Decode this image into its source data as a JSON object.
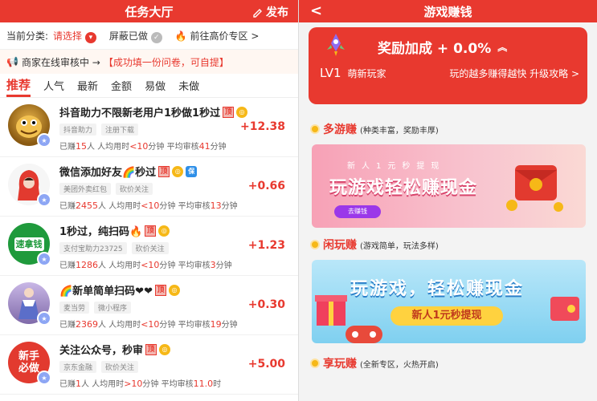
{
  "left": {
    "title": "任务大厅",
    "publish_label": "发布",
    "filter": {
      "current_label": "当前分类:",
      "select_label": "请选择",
      "hidden_label": "屏蔽已做",
      "premium_label": "前往高价专区 >"
    },
    "notice": {
      "text": "商家在线审核中 →",
      "highlight": "【成功填一份问卷，可自提】"
    },
    "tabs": [
      "推荐",
      "人气",
      "最新",
      "金额",
      "易做",
      "未做"
    ],
    "tasks": [
      {
        "title": "抖音助力不限新老用户1秒做1秒过",
        "chips": [
          "抖音助力",
          "注册下载"
        ],
        "earned_count": "15",
        "avg_time": "<10",
        "avg_review": "41",
        "price": "+12.38",
        "avatar_text": ""
      },
      {
        "title": "微信添加好友🌈秒过",
        "chips": [
          "美团外卖红包",
          "砍价关注"
        ],
        "earned_count": "2455",
        "avg_time": "<10",
        "avg_review": "13",
        "price": "+0.66",
        "avatar_text": ""
      },
      {
        "title": "1秒过，纯扫码🔥",
        "chips": [
          "支付宝助力23725",
          "砍价关注"
        ],
        "earned_count": "1286",
        "avg_time": "<10",
        "avg_review": "3",
        "price": "+1.23",
        "avatar_text": "速拿钱"
      },
      {
        "title": "🌈新单简单扫码❤❤",
        "chips": [
          "麦当劳",
          "微小程序"
        ],
        "earned_count": "2369",
        "avg_time": "<10",
        "avg_review": "19",
        "price": "+0.30",
        "avatar_text": ""
      },
      {
        "title": "关注公众号，秒审",
        "chips": [
          "京东金融",
          "砍价关注"
        ],
        "earned_count": "1",
        "avg_time": ">10",
        "avg_review": "11.0",
        "price": "+5.00",
        "avatar_text": "新手必做"
      }
    ],
    "meta_labels": {
      "earned_prefix": "已赚",
      "earned_suffix": "人 人均用时",
      "time_unit": "分钟",
      "review_prefix": " 平均审核",
      "review_unit": "分钟",
      "review_unit_last": "时"
    }
  },
  "right": {
    "title": "游戏赚钱",
    "back_label": "<",
    "reward": {
      "label": "奖励加成 + 0.0%",
      "level": "LV1",
      "level_name": "萌新玩家",
      "hint": "玩的越多赚得越快 升级攻略 >"
    },
    "sections": [
      {
        "name": "多游赚",
        "sub": "(种类丰富，奖励丰厚)"
      },
      {
        "name": "闲玩赚",
        "sub": "(游戏简单，玩法多样)"
      },
      {
        "name": "享玩赚",
        "sub": "(全新专区，火热开启)"
      }
    ],
    "banner1": {
      "small": "新人1元秒提现",
      "big": "玩游戏轻松赚现金",
      "button": "去赚钱"
    },
    "banner2": {
      "big": "玩游戏，轻松赚现金",
      "pill": "新人1元秒提现"
    }
  },
  "colors": {
    "brand_red": "#e8392f",
    "coin_gold": "#f6b817"
  }
}
